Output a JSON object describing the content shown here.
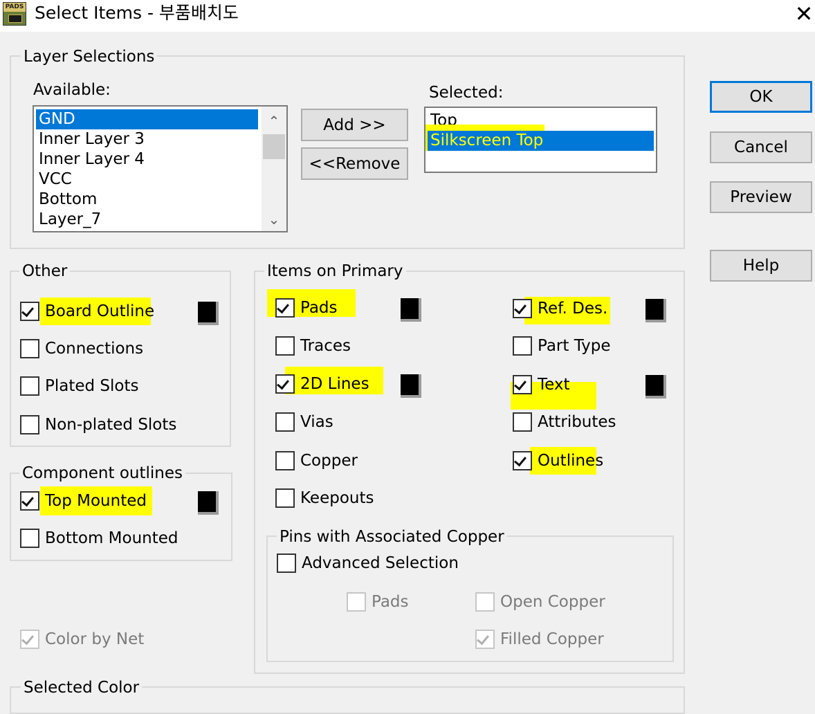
{
  "window": {
    "app_icon_text": "PADS",
    "title": "Select Items - 부품배치도",
    "close_glyph": "✕"
  },
  "layer_selections": {
    "legend": "Layer Selections",
    "available_label": "Available:",
    "available_items": [
      "GND",
      "Inner Layer 3",
      "Inner Layer 4",
      "VCC",
      "Bottom",
      "Layer_7"
    ],
    "available_selected": "GND",
    "selected_label": "Selected:",
    "selected_items": [
      "Top",
      "Silkscreen Top"
    ],
    "selected_selected": "Silkscreen Top",
    "add_button": "Add >>",
    "remove_button": "<<Remove",
    "scroll_up_glyph": "⌃",
    "scroll_down_glyph": "⌄"
  },
  "buttons": {
    "ok": "OK",
    "cancel": "Cancel",
    "preview": "Preview",
    "help": "Help"
  },
  "other": {
    "legend": "Other",
    "board_outline": "Board Outline",
    "connections": "Connections",
    "plated_slots": "Plated Slots",
    "non_plated_slots": "Non-plated Slots"
  },
  "component_outlines": {
    "legend": "Component outlines",
    "top_mounted": "Top Mounted",
    "bottom_mounted": "Bottom Mounted"
  },
  "color_by_net": "Color by Net",
  "items_on_primary": {
    "legend": "Items on Primary",
    "pads": "Pads",
    "traces": "Traces",
    "lines_2d": "2D Lines",
    "vias": "Vias",
    "copper": "Copper",
    "keepouts": "Keepouts",
    "ref_des": "Ref. Des.",
    "part_type": "Part Type",
    "text": "Text",
    "attributes": "Attributes",
    "outlines": "Outlines"
  },
  "pins_with_associated_copper": {
    "legend": "Pins with Associated Copper",
    "advanced_selection": "Advanced Selection",
    "pads": "Pads",
    "open_copper": "Open Copper",
    "filled_copper": "Filled Copper"
  },
  "selected_color": {
    "legend": "Selected Color"
  },
  "checked_state": {
    "board_outline": true,
    "connections": false,
    "plated_slots": false,
    "non_plated_slots": false,
    "top_mounted": true,
    "bottom_mounted": false,
    "color_by_net": true,
    "pads": true,
    "traces": false,
    "lines_2d": true,
    "vias": false,
    "copper": false,
    "keepouts": false,
    "ref_des": true,
    "part_type": false,
    "text": true,
    "attributes": false,
    "outlines": true,
    "advanced_selection": false,
    "pins_pads": false,
    "open_copper": false,
    "filled_copper": true
  },
  "colors": {
    "highlight": "#ffff00",
    "selection_blue": "#0078d7",
    "swatch": "#000000"
  }
}
